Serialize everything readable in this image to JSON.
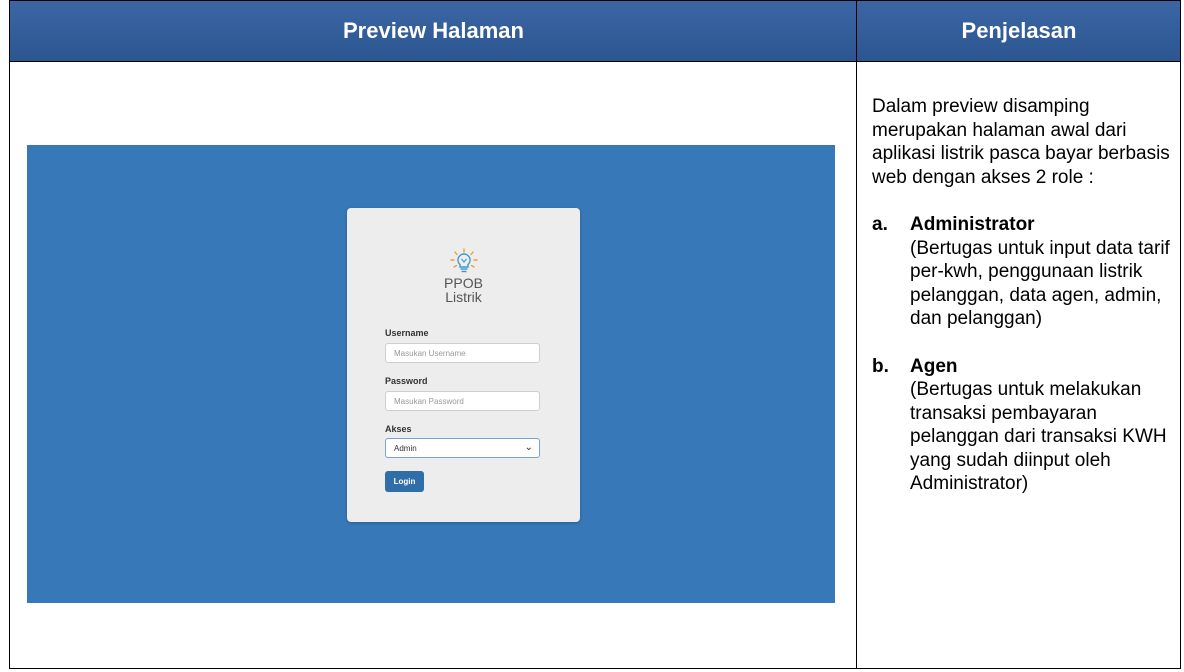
{
  "header": {
    "left": "Preview Halaman",
    "right": "Penjelasan"
  },
  "preview": {
    "logo_line1": "PPOB",
    "logo_line2": "Listrik",
    "username_label": "Username",
    "username_placeholder": "Masukan Username",
    "password_label": "Password",
    "password_placeholder": "Masukan Password",
    "akses_label": "Akses",
    "akses_selected": "Admin",
    "login_label": "Login"
  },
  "explanation": {
    "intro": "Dalam preview disamping merupakan halaman awal dari aplikasi listrik pasca bayar berbasis web dengan akses 2 role :",
    "items": [
      {
        "marker": "a.",
        "title": "Administrator",
        "desc": "(Bertugas untuk input data tarif per-kwh, penggunaan listrik pelanggan, data agen, admin, dan pelanggan)"
      },
      {
        "marker": "b.",
        "title": "Agen",
        "desc": "(Bertugas untuk melakukan transaksi pembayaran pelanggan dari transaksi KWH yang sudah diinput oleh Administrator)"
      }
    ]
  },
  "colors": {
    "header_bg": "#2f5b97",
    "preview_bg": "#3779b8",
    "login_button": "#2f6ea9",
    "logo_accent": "#f0a030"
  }
}
